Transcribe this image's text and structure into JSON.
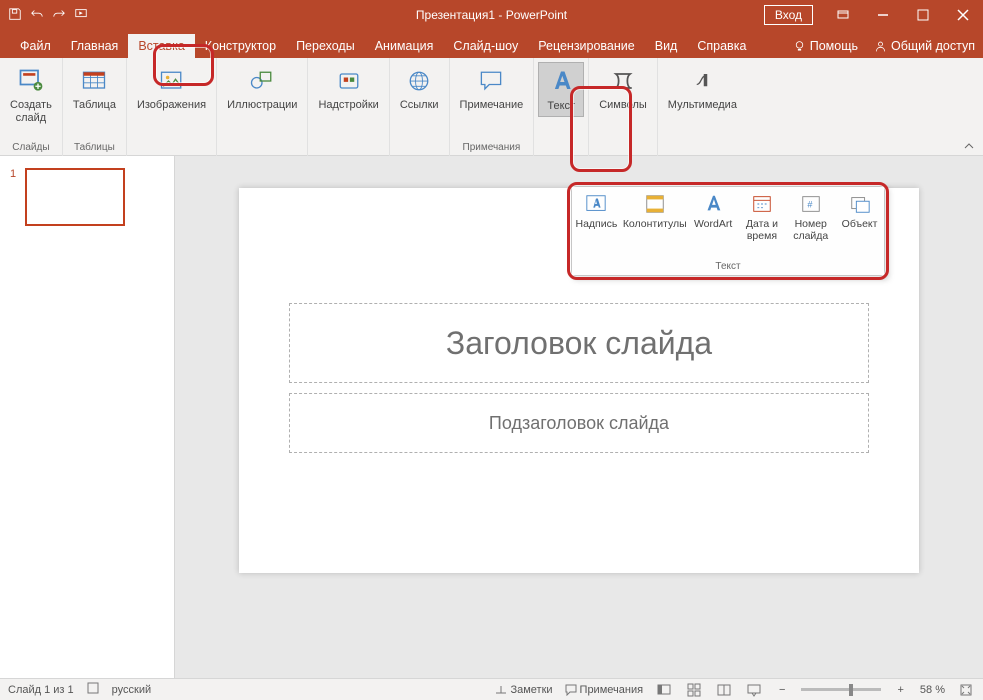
{
  "titlebar": {
    "title": "Презентация1 - PowerPoint",
    "signin": "Вход"
  },
  "tabs": {
    "file": "Файл",
    "home": "Главная",
    "insert": "Вставка",
    "design": "Конструктор",
    "transitions": "Переходы",
    "animations": "Анимация",
    "slideshow": "Слайд-шоу",
    "review": "Рецензирование",
    "view": "Вид",
    "help": "Справка",
    "tell_me": "Помощь",
    "share": "Общий доступ"
  },
  "ribbon": {
    "new_slide": "Создать\nслайд",
    "group_slides": "Слайды",
    "table": "Таблица",
    "group_tables": "Таблицы",
    "images": "Изображения",
    "illustrations": "Иллюстрации",
    "addins": "Надстройки",
    "links": "Ссылки",
    "comment": "Примечание",
    "group_comments": "Примечания",
    "text": "Текст",
    "symbols": "Символы",
    "media": "Мультимедиа"
  },
  "text_flyout": {
    "textbox": "Надпись",
    "headerfooter": "Колонтитулы",
    "wordart": "WordArt",
    "datetime": "Дата и\nвремя",
    "slidenum": "Номер\nслайда",
    "object": "Объект",
    "group": "Текст"
  },
  "thumbs": {
    "n1": "1"
  },
  "slide": {
    "title_ph": "Заголовок слайда",
    "subtitle_ph": "Подзаголовок слайда"
  },
  "status": {
    "slide": "Слайд 1 из 1",
    "lang": "русский",
    "notes": "Заметки",
    "comments": "Примечания",
    "zoom_pct": "58 %"
  },
  "colors": {
    "accent": "#b7472a"
  }
}
